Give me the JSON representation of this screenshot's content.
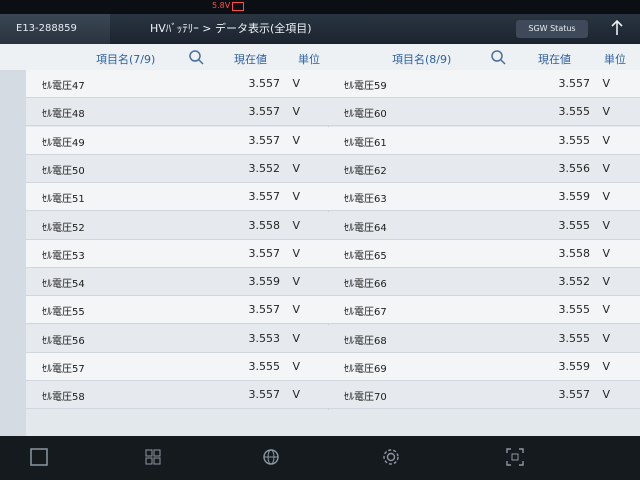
{
  "statusbar": {
    "voltage": "5.8V"
  },
  "header": {
    "vin": "E13-288859",
    "breadcrumb": "HVﾊﾞｯﾃﾘｰ > データ表示(全項目)",
    "sgw_status": "SGW Status"
  },
  "left": {
    "col_name": "項目名(7/9)",
    "col_value": "現在値",
    "col_unit": "単位",
    "rows": [
      {
        "name": "ｾﾙ電圧47",
        "value": "3.557",
        "unit": "V"
      },
      {
        "name": "ｾﾙ電圧48",
        "value": "3.557",
        "unit": "V"
      },
      {
        "name": "ｾﾙ電圧49",
        "value": "3.557",
        "unit": "V"
      },
      {
        "name": "ｾﾙ電圧50",
        "value": "3.552",
        "unit": "V"
      },
      {
        "name": "ｾﾙ電圧51",
        "value": "3.557",
        "unit": "V"
      },
      {
        "name": "ｾﾙ電圧52",
        "value": "3.558",
        "unit": "V"
      },
      {
        "name": "ｾﾙ電圧53",
        "value": "3.557",
        "unit": "V"
      },
      {
        "name": "ｾﾙ電圧54",
        "value": "3.559",
        "unit": "V"
      },
      {
        "name": "ｾﾙ電圧55",
        "value": "3.557",
        "unit": "V"
      },
      {
        "name": "ｾﾙ電圧56",
        "value": "3.553",
        "unit": "V"
      },
      {
        "name": "ｾﾙ電圧57",
        "value": "3.555",
        "unit": "V"
      },
      {
        "name": "ｾﾙ電圧58",
        "value": "3.557",
        "unit": "V"
      }
    ]
  },
  "right": {
    "col_name": "項目名(8/9)",
    "col_value": "現在値",
    "col_unit": "単位",
    "rows": [
      {
        "name": "ｾﾙ電圧59",
        "value": "3.557",
        "unit": "V"
      },
      {
        "name": "ｾﾙ電圧60",
        "value": "3.555",
        "unit": "V"
      },
      {
        "name": "ｾﾙ電圧61",
        "value": "3.555",
        "unit": "V"
      },
      {
        "name": "ｾﾙ電圧62",
        "value": "3.556",
        "unit": "V"
      },
      {
        "name": "ｾﾙ電圧63",
        "value": "3.559",
        "unit": "V"
      },
      {
        "name": "ｾﾙ電圧64",
        "value": "3.555",
        "unit": "V"
      },
      {
        "name": "ｾﾙ電圧65",
        "value": "3.558",
        "unit": "V"
      },
      {
        "name": "ｾﾙ電圧66",
        "value": "3.552",
        "unit": "V"
      },
      {
        "name": "ｾﾙ電圧67",
        "value": "3.555",
        "unit": "V"
      },
      {
        "name": "ｾﾙ電圧68",
        "value": "3.555",
        "unit": "V"
      },
      {
        "name": "ｾﾙ電圧69",
        "value": "3.559",
        "unit": "V"
      },
      {
        "name": "ｾﾙ電圧70",
        "value": "3.557",
        "unit": "V"
      }
    ]
  },
  "pager": {
    "total": 9,
    "active_index": 7
  },
  "navbar": {
    "icons": [
      "square-icon",
      "grid-icon",
      "globe-icon",
      "gear-icon",
      "scan-icon"
    ]
  }
}
